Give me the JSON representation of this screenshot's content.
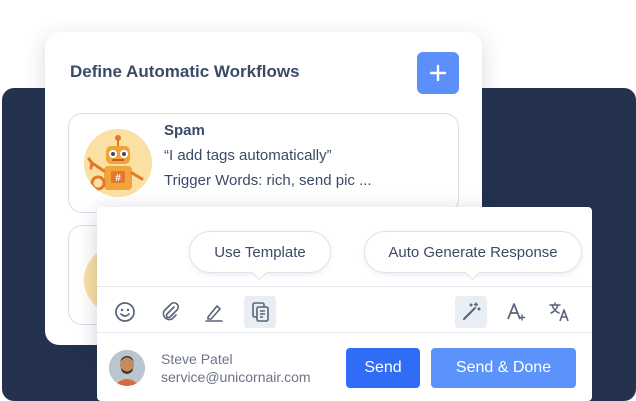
{
  "workflows": {
    "title": "Define Automatic Workflows",
    "add_label": "+",
    "items": [
      {
        "name": "Spam",
        "description": "“I add tags automatically”",
        "trigger": "Trigger Words: rich, send pic ..."
      }
    ]
  },
  "composer": {
    "use_template_label": "Use Template",
    "auto_generate_label": "Auto Generate Response",
    "toolbar_icons": [
      "emoji-icon",
      "attachment-icon",
      "signature-icon",
      "template-icon",
      "magic-wand-icon",
      "font-icon",
      "translate-icon"
    ],
    "agent_name": "Steve Patel",
    "agent_email": "service@unicornair.com",
    "send_label": "Send",
    "send_done_label": "Send & Done"
  },
  "colors": {
    "navy": "#24324e",
    "accent": "#2f6df6",
    "accent_light": "#5b93fb"
  }
}
